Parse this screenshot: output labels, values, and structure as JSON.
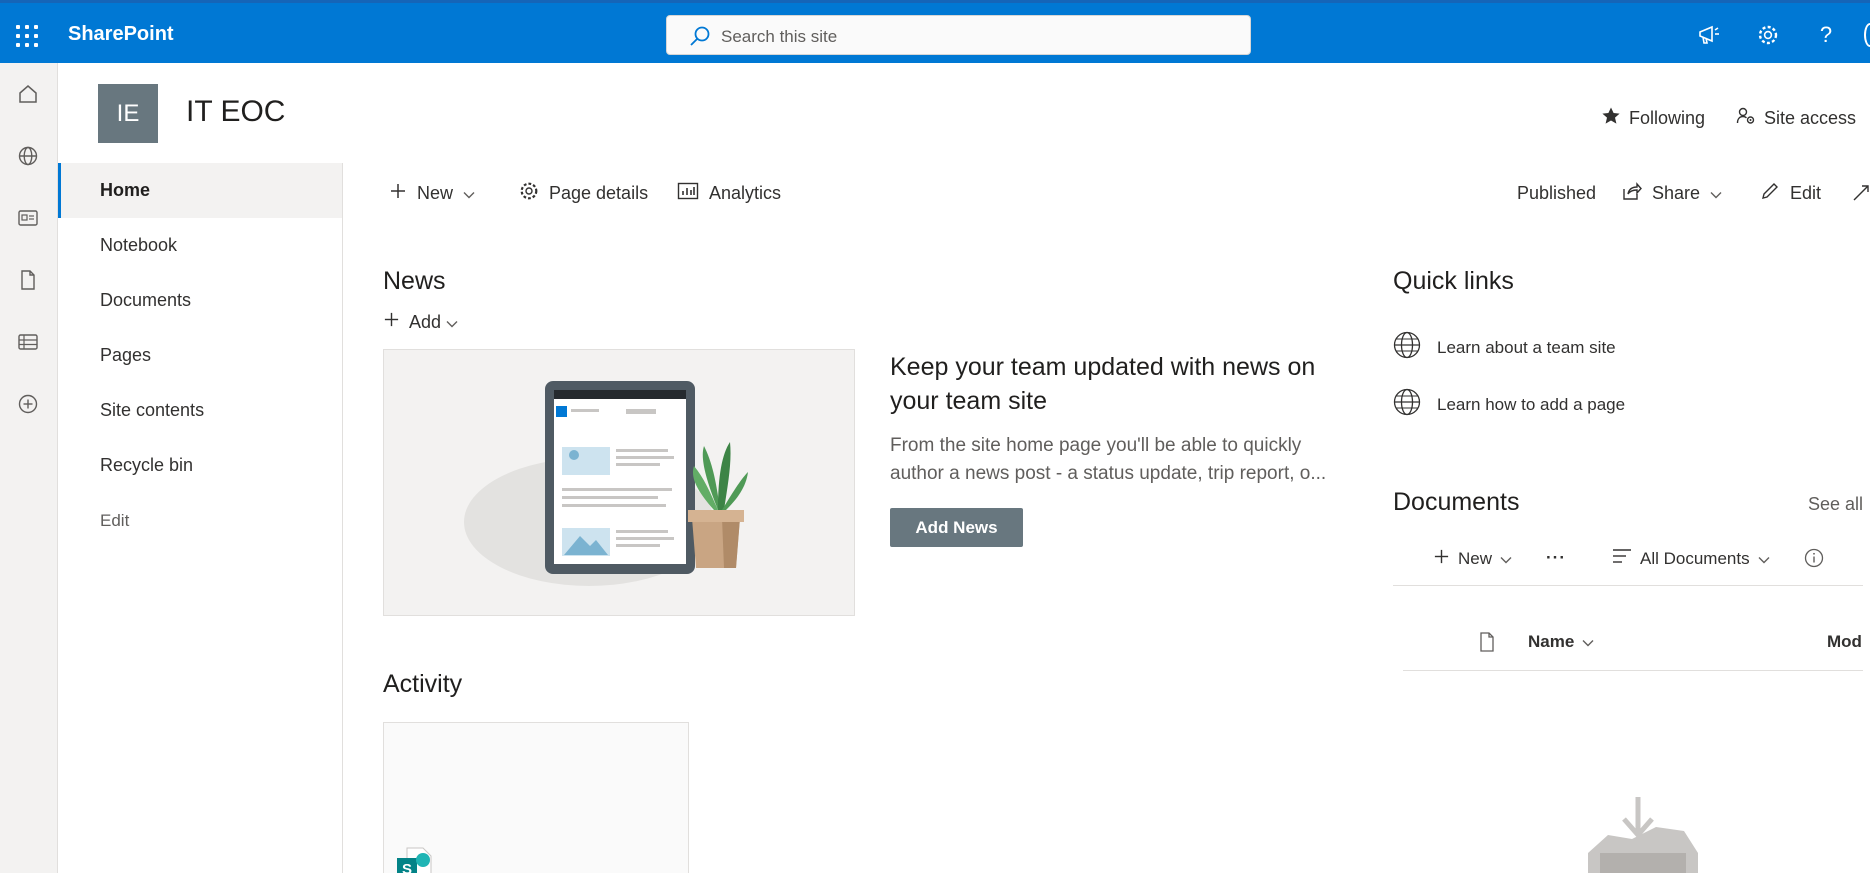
{
  "suite": {
    "brand": "SharePoint",
    "search_placeholder": "Search this site",
    "icons": [
      "waffle-icon",
      "megaphone-icon",
      "settings-icon",
      "help-icon"
    ],
    "accent": "#0078d4"
  },
  "rail": {
    "icons": [
      "home-icon",
      "globe-icon",
      "news-icon",
      "file-icon",
      "list-icon",
      "add-icon"
    ]
  },
  "site": {
    "logo_initials": "IE",
    "title": "IT EOC",
    "following_label": "Following",
    "site_access_label": "Site access",
    "logo_color": "#68777f"
  },
  "nav": {
    "items": [
      {
        "label": "Home"
      },
      {
        "label": "Notebook"
      },
      {
        "label": "Documents"
      },
      {
        "label": "Pages"
      },
      {
        "label": "Site contents"
      },
      {
        "label": "Recycle bin"
      }
    ],
    "active": "Home",
    "edit_label": "Edit"
  },
  "command_bar": {
    "new_label": "New",
    "page_details_label": "Page details",
    "analytics_label": "Analytics",
    "status_label": "Published",
    "share_label": "Share",
    "edit_label": "Edit"
  },
  "news": {
    "title": "News",
    "add_label": "Add",
    "headline": "Keep your team updated with news on your team site",
    "body": "From the site home page you'll be able to quickly author a news post - a status update, trip report, o...",
    "button_label": "Add News"
  },
  "activity": {
    "title": "Activity"
  },
  "quick_links": {
    "title": "Quick links",
    "items": [
      {
        "label": "Learn about a team site"
      },
      {
        "label": "Learn how to add a page"
      }
    ]
  },
  "documents": {
    "title": "Documents",
    "see_all_label": "See all",
    "new_label": "New",
    "more_label": "···",
    "view_label": "All Documents",
    "column_name": "Name",
    "column_modified": "Mod"
  }
}
